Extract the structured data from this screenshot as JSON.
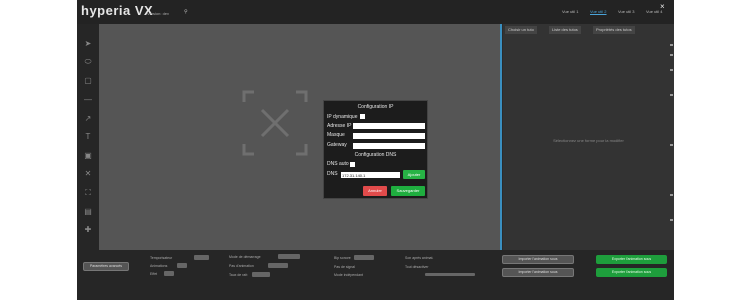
{
  "app": {
    "logo": "hyperia VX",
    "version": "Version: dev",
    "user_icon": "user-icon",
    "tabs": [
      "Vue util 1",
      "Vue util 2",
      "Vue util 3",
      "Vue util 4"
    ],
    "active_tab_index": 1,
    "close_label": "×"
  },
  "toolbar": {
    "tools": [
      "cursor-icon",
      "ellipse-icon",
      "rectangle-icon",
      "line-icon",
      "arrow-icon",
      "text-icon",
      "image-icon",
      "cross-icon",
      "fullscreen-icon",
      "layout-icon",
      "plus-icon"
    ]
  },
  "right_panel": {
    "tabs": [
      "Choisir un tuto",
      "Liste des tutos",
      "Propriétés des tutos"
    ],
    "message": "Sélectionnez une forme pour la modifier"
  },
  "bottom": {
    "main_button": "Paramètres avancés",
    "col1": [
      "Temporisateur",
      "Animations",
      "Effet"
    ],
    "col2": [
      "Mode de démarrage",
      "Pas d'animation",
      "Taux de rafr."
    ],
    "col3": [
      "Bip sonore",
      "Pas de signal",
      "Mode indépendant"
    ],
    "col4": [
      "Son après animat.",
      "Tout désactiver"
    ],
    "gray_buttons": [
      "Importer l'animation sous",
      "Importer l'animation sous"
    ],
    "green_buttons": [
      "Exporter l'animation sous",
      "Exporter l'animation sous"
    ]
  },
  "modal": {
    "title": "Configuration IP",
    "dhcp_label": "IP dynamique",
    "ip_label": "Adresse IP",
    "mask_label": "Masque",
    "gateway_label": "Gateway",
    "dns_title": "Configuration DNS",
    "dns_auto_label": "DNS auto",
    "dns_label": "DNS",
    "dns_value": "172.31.140.1",
    "add_label": "Ajouter",
    "cancel_label": "Annuler",
    "save_label": "Sauvegarder"
  },
  "colors": {
    "accent": "#3a8fc0",
    "green": "#1fae3f",
    "red": "#e24b4b",
    "modal_bg": "#1c1c1c"
  }
}
